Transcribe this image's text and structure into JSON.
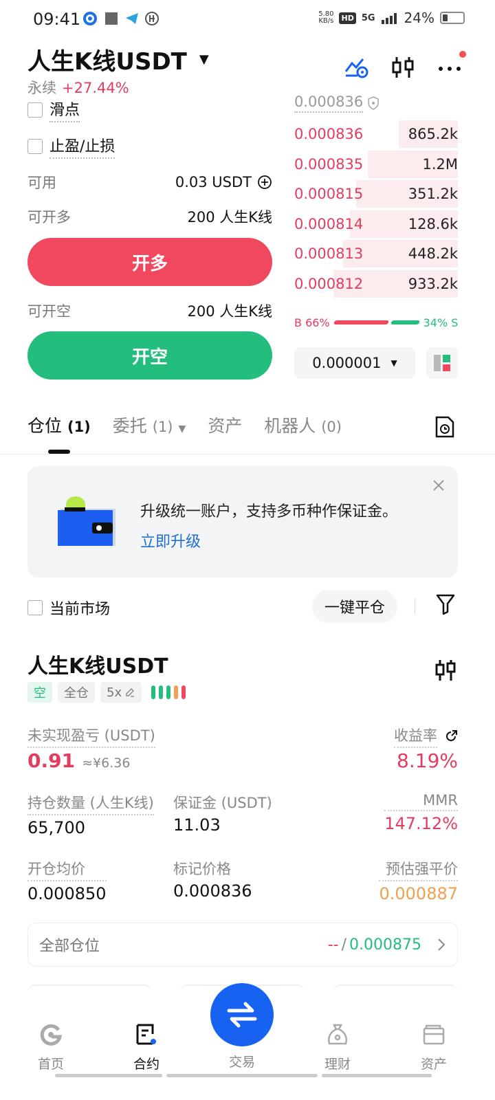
{
  "status_bar": {
    "time": "09:41",
    "net_speed_value": "5.80",
    "net_speed_unit": "KB/s",
    "hd": "HD",
    "signal": "5G",
    "battery": "24%"
  },
  "header": {
    "title": "人生K线USDT",
    "type": "永续",
    "change": "+27.44%"
  },
  "trade_panel": {
    "slippage": "滑点",
    "tpsl": "止盈/止损",
    "available_label": "可用",
    "available_value": "0.03 USDT",
    "max_long_label": "可开多",
    "max_long_value": "200 人生K线",
    "long_button": "开多",
    "max_short_label": "可开空",
    "max_short_value": "200 人生K线",
    "short_button": "开空"
  },
  "order_book": {
    "last_price": "0.000836",
    "rows": [
      {
        "price": "0.000836",
        "qty": "865.2k",
        "depth": 0.36
      },
      {
        "price": "0.000835",
        "qty": "1.2M",
        "depth": 0.55
      },
      {
        "price": "0.000815",
        "qty": "351.2k",
        "depth": 0.62
      },
      {
        "price": "0.000814",
        "qty": "128.6k",
        "depth": 0.66
      },
      {
        "price": "0.000813",
        "qty": "448.2k",
        "depth": 0.7
      },
      {
        "price": "0.000812",
        "qty": "933.2k",
        "depth": 0.76
      }
    ],
    "buy_ratio": "B 66%",
    "sell_ratio": "34% S",
    "buy_fraction": 0.66,
    "precision": "0.000001"
  },
  "tabs": [
    {
      "label": "仓位",
      "count": "(1)"
    },
    {
      "label": "委托",
      "count": "(1)"
    },
    {
      "label": "资产",
      "count": ""
    },
    {
      "label": "机器人",
      "count": "(0)"
    }
  ],
  "banner": {
    "text": "升级统一账户，支持多币种作保证金。",
    "link": "立即升级"
  },
  "filter": {
    "current_market": "当前市场",
    "close_all": "一键平仓"
  },
  "position": {
    "symbol": "人生K线USDT",
    "side": "空",
    "margin_mode": "全仓",
    "leverage": "5x",
    "upnl_label": "未实现盈亏 (USDT)",
    "upnl_value": "0.91",
    "upnl_cny": "≈¥6.36",
    "roe_label": "收益率",
    "roe_value": "8.19%",
    "size_label": "持仓数量 (人生K线)",
    "size_value": "65,700",
    "margin_label": "保证金 (USDT)",
    "margin_value": "11.03",
    "mmr_label": "MMR",
    "mmr_value": "147.12%",
    "entry_label": "开仓均价",
    "entry_value": "0.000850",
    "mark_label": "标记价格",
    "mark_value": "0.000836",
    "liq_label": "预估强平价",
    "liq_value": "0.000887",
    "all_positions": "全部仓位",
    "all_dash": "--",
    "all_price": "0.000875"
  },
  "bottom_nav": {
    "home": "首页",
    "futures": "合约",
    "trade": "交易",
    "earn": "理财",
    "assets": "资产"
  },
  "colors": {
    "red": "#e23c5f",
    "green": "#23bd7e",
    "blue": "#1762f0",
    "orange": "#f0a050"
  }
}
